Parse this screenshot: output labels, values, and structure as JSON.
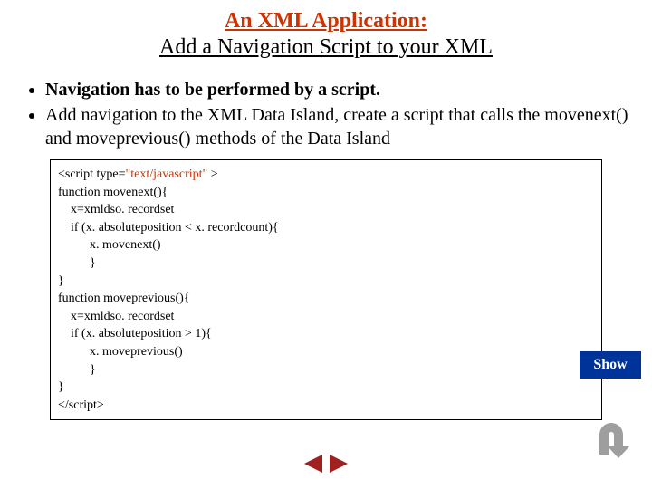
{
  "title": {
    "line1": "An XML Application:",
    "line2": "Add a Navigation Script to your XML"
  },
  "bullets": {
    "item1": "Navigation has to be performed by a script.",
    "item2": "Add navigation to the XML Data Island, create a script that calls the movenext() and moveprevious() methods of the Data Island"
  },
  "code": {
    "l0a": "<script type=",
    "l0b": "\"text/javascript\"",
    "l0c": " >",
    "l1": "function movenext(){",
    "l2": "    x=xmldso. recordset",
    "l3": "    if (x. absoluteposition < x. recordcount){",
    "l4": "          x. movenext()",
    "l5": "          }",
    "l6": "}",
    "l7": "function moveprevious(){",
    "l8": "    x=xmldso. recordset",
    "l9": "    if (x. absoluteposition > 1){",
    "l10": "          x. moveprevious()",
    "l11": "          }",
    "l12": "}",
    "l13": "</script>"
  },
  "buttons": {
    "show_label": "Show"
  },
  "icons": {
    "uturn": "uturn-icon",
    "prev": "prev-arrow-icon",
    "next": "next-arrow-icon"
  },
  "colors": {
    "accent": "#cc3300",
    "button_bg": "#003399",
    "icon_gray": "#9e9e9e",
    "arrow_red": "#a02020"
  }
}
